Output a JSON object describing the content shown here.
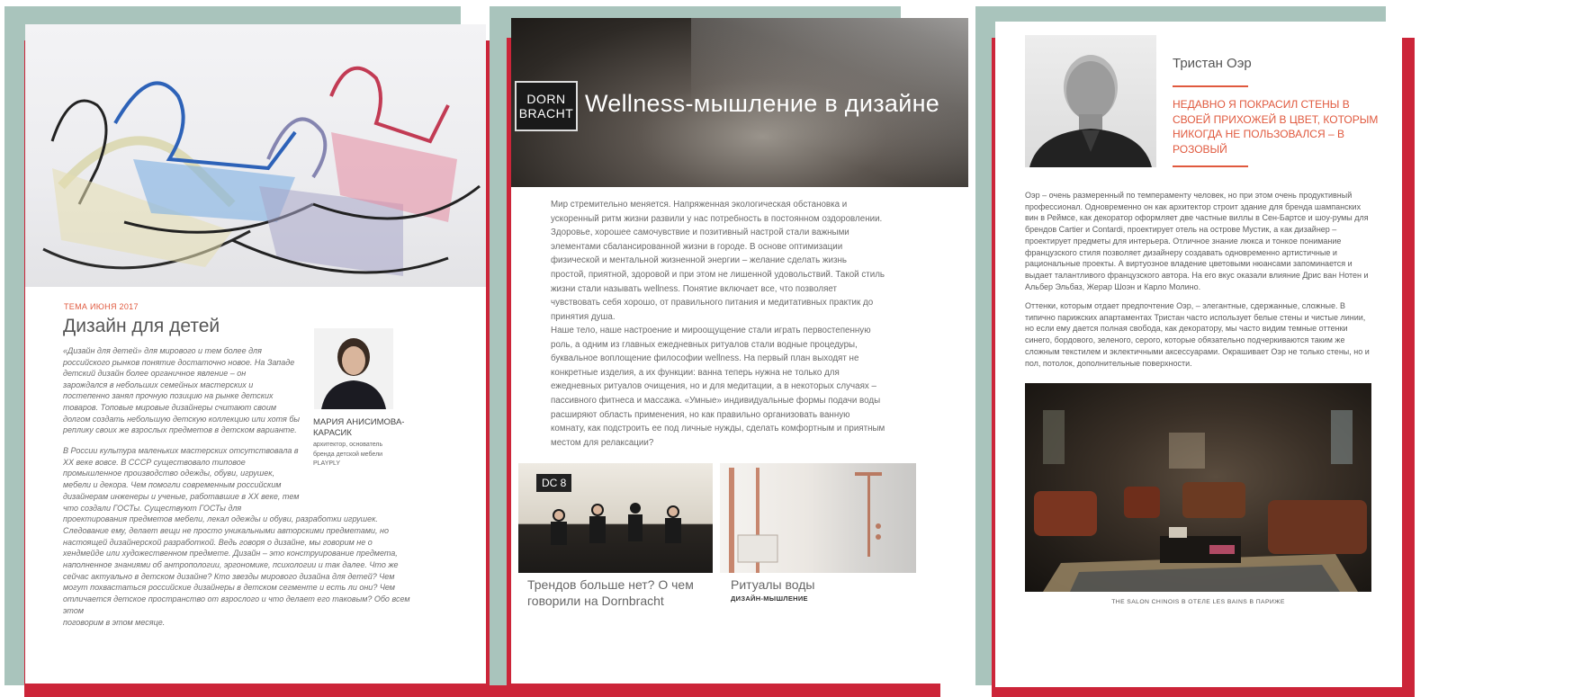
{
  "colors": {
    "accent_red": "#cc2539",
    "accent_green": "#a9c4bc",
    "heading_orange": "#e0593e"
  },
  "page1": {
    "kicker": "ТЕМА ИЮНЯ 2017",
    "title": "Дизайн для детей",
    "lead_lines": [
      "«Дизайн для детей» для мирового и тем более для",
      "российского рынков понятие достаточно новое. На Западе",
      "детский дизайн более органичное явление – он",
      "зарождался в небольших семейных мастерских и",
      "постепенно занял прочную позицию на рынке детских",
      "товаров. Топовые мировые дизайнеры считают своим",
      "долгом создать небольшую детскую коллекцию или хотя бы",
      "реплику своих же взрослых предметов в детском варианте."
    ],
    "body_lines": [
      "В России культура маленьких мастерских отсутствовала в",
      "XX веке вовсе. В СССР существовало типовое",
      "промышленное производство одежды, обуви, игрушек,",
      "мебели и декора. Чем помогли современным российским",
      "дизайнерам инженеры и ученые, работавшие в XX веке, тем",
      "что создали ГОСТы. Существуют ГОСТы для",
      "проектирования предметов мебели, лекал одежды и обуви, разработки игрушек.",
      "Следование ему, делает вещи не просто уникальными авторскими предметами, но",
      "настоящей дизайнерской разработкой. Ведь говоря о дизайне, мы говорим не о",
      "хендмейде или художественном предмете. Дизайн – это конструирование предмета,",
      "наполненное знаниями об антропологии, эргономике, психологии и так далее. Что же",
      "сейчас актуально в детском дизайне? Кто звезды мирового дизайна для детей? Чем",
      "могут похвастаться российские дизайнеры в детском сегменте и есть ли они? Чем",
      "отличается детское пространство от взрослого и что делает его таковым? Обо всем этом",
      "поговорим в этом месяце."
    ],
    "author_name_line1": "МАРИЯ АНИСИМОВА-",
    "author_name_line2": "КАРАСИК",
    "author_role_lines": [
      "архитектор, основатель",
      "бренда детской мебели",
      "PLAYPLY"
    ]
  },
  "page2": {
    "logo_line1": "DORN",
    "logo_line2": "BRACHT",
    "title": "Wellness-мышление в дизайне",
    "para1_lines": [
      "Мир стремительно меняется. Напряженная экологическая обстановка и",
      "ускоренный ритм жизни развили у нас потребность в постоянном оздоровлении.",
      "Здоровье, хорошее самочувствие и позитивный настрой стали важными",
      "элементами сбалансированной жизни в городе. В основе оптимизации",
      "физической и ментальной жизненной энергии – желание сделать жизнь",
      "простой, приятной, здоровой и при этом не лишенной удовольствий. Такой стиль",
      "жизни стали называть wellness. Понятие включает все, что позволяет",
      "чувствовать себя хорошо, от правильного питания и медитативных практик до",
      "принятия душа."
    ],
    "para2_lines": [
      "Наше тело, наше настроение и мироощущение стали играть первостепенную",
      "роль, а одним из главных ежедневных ритуалов стали водные процедуры,",
      "буквальное воплощение философии wellness. На первый план выходят не",
      "конкретные изделия, а их функции: ванна теперь нужна не только для",
      "ежедневных ритуалов очищения, но и для медитации, а в некоторых случаях –",
      "пассивного фитнеса и массажа. «Умные» индивидуальные формы подачи воды",
      "расширяют область применения, но как правильно организовать ванную",
      "комнату, как подстроить ее под личные нужды, сделать комфортным и приятным",
      "местом для релаксации?"
    ],
    "card1_badge": "DC 8",
    "card1_title_lines": [
      "Трендов больше нет? О чем",
      "говорили на Dornbracht"
    ],
    "card2_title": "Ритуалы воды",
    "card2_sub": "ДИЗАЙН-МЫШЛЕНИЕ"
  },
  "page3": {
    "name": "Тристан Оэр",
    "quote_lines": [
      "НЕДАВНО Я ПОКРАСИЛ СТЕНЫ В",
      "СВОЕЙ ПРИХОЖЕЙ В ЦВЕТ, КОТОРЫМ",
      "НИКОГДА НЕ ПОЛЬЗОВАЛСЯ – В",
      "РОЗОВЫЙ"
    ],
    "para1_lines": [
      "Оэр – очень размеренный по темпераменту человек, но при этом очень продуктивный",
      "профессионал. Одновременно он как архитектор строит здание для бренда шампанских",
      "вин в Реймсе, как декоратор оформляет две частные виллы в Сен-Бартсе и шоу-румы для",
      "брендов Cartier и Contardi, проектирует отель на острове Мустик, а как дизайнер –",
      "проектирует предметы для интерьера. Отличное знание люкса и тонкое понимание",
      "французского стиля позволяет дизайнеру создавать одновременно артистичные и",
      "рациональные проекты. А виртуозное владение цветовыми нюансами запоминается и",
      "выдает талантливого французского автора. На его вкус оказали влияние Дрис ван Нотен и",
      "Альбер Эльбаз, Жерар Шоэн и Карло Молино."
    ],
    "para2_lines": [
      "Оттенки, которым отдает предпочтение Оэр, – элегантные, сдержанные, сложные. В",
      "типично парижских апартаментах Тристан часто использует белые стены и чистые линии,",
      "но если ему дается полная свобода, как декоратору, мы часто видим темные оттенки",
      "синего, бордового, зеленого, серого, которые обязательно подчеркиваются таким же",
      "сложным текстилем и эклектичными аксессуарами. Окрашивает Оэр не только стены, но и",
      "пол, потолок, дополнительные поверхности."
    ],
    "caption": "THE SALON CHINOIS В ОТЕЛЕ LES BAINS В ПАРИЖЕ"
  }
}
